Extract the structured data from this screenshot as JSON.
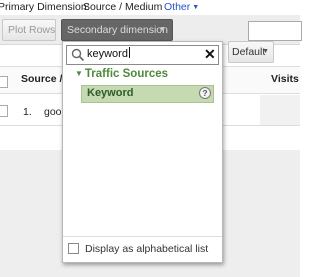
{
  "primary_dimension": {
    "label": "Primary Dimension:",
    "value": "Source / Medium",
    "other_label": "Other",
    "other_caret_icon": "chevron-down-icon"
  },
  "toolbar": {
    "plot_rows_label": "Plot Rows",
    "secondary_dimension_label": "Secondary dimension",
    "default_label": "Default"
  },
  "table": {
    "headers": {
      "source": "Source / M",
      "visits": "Visits"
    },
    "rows": [
      {
        "num": "1.",
        "source": "goo"
      }
    ]
  },
  "dropdown": {
    "search_value": "keyword",
    "group_label": "Traffic Sources",
    "items": [
      {
        "label": "Keyword",
        "help_icon": "?"
      }
    ],
    "alphabetical_label": "Display as alphabetical list",
    "accent_color": "#4e8a3a"
  }
}
